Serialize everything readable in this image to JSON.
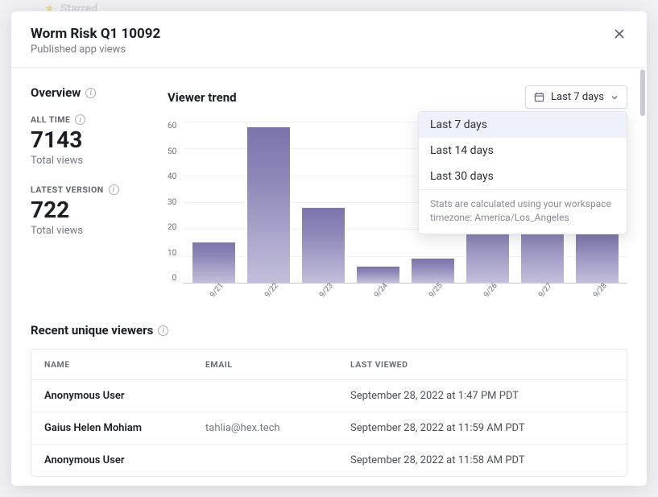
{
  "backdrop": {
    "starred_label": "Starred"
  },
  "header": {
    "title": "Worm Risk Q1 10092",
    "subtitle": "Published app views"
  },
  "overview": {
    "heading": "Overview",
    "all_time": {
      "label": "ALL TIME",
      "value": "7143",
      "caption": "Total views"
    },
    "latest_version": {
      "label": "LATEST VERSION",
      "value": "722",
      "caption": "Total views"
    }
  },
  "trend": {
    "heading": "Viewer trend",
    "range_selected": "Last 7 days",
    "range_options": [
      "Last 7 days",
      "Last 14 days",
      "Last 30 days"
    ],
    "range_footer": "Stats are calculated using your workspace timezone: America/Los_Angeles"
  },
  "chart_data": {
    "type": "bar",
    "categories": [
      "9/21",
      "9/22",
      "9/23",
      "9/24",
      "9/25",
      "9/26",
      "9/27",
      "9/28"
    ],
    "values": [
      15,
      58,
      28,
      6,
      9,
      25,
      25,
      20
    ],
    "ylabel": "",
    "xlabel": "",
    "ylim": [
      0,
      60
    ],
    "y_ticks": [
      0,
      10,
      20,
      30,
      40,
      50,
      60
    ]
  },
  "recent": {
    "heading": "Recent unique viewers",
    "columns": {
      "name": "NAME",
      "email": "EMAIL",
      "last_viewed": "LAST VIEWED"
    },
    "rows": [
      {
        "name": "Anonymous User",
        "email": "",
        "last_viewed": "September 28, 2022 at 1:47 PM PDT"
      },
      {
        "name": "Gaius Helen Mohiam",
        "email": "tahlia@hex.tech",
        "last_viewed": "September 28, 2022 at 11:59 AM PDT"
      },
      {
        "name": "Anonymous User",
        "email": "",
        "last_viewed": "September 28, 2022 at 11:58 AM PDT"
      }
    ]
  }
}
